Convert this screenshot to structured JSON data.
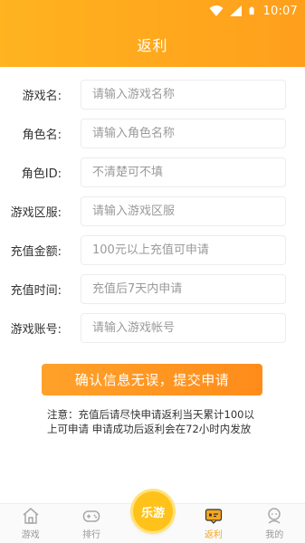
{
  "status_bar": {
    "time": "10:07"
  },
  "header": {
    "title": "返利"
  },
  "form": {
    "fields": [
      {
        "label": "游戏名:",
        "placeholder": "请输入游戏名称"
      },
      {
        "label": "角色名:",
        "placeholder": "请输入角色名称"
      },
      {
        "label": "角色ID:",
        "placeholder": "不清楚可不填"
      },
      {
        "label": "游戏区服:",
        "placeholder": "请输入游戏区服"
      },
      {
        "label": "充值金额:",
        "placeholder": "100元以上充值可申请"
      },
      {
        "label": "充值时间:",
        "placeholder": "充值后7天内申请"
      },
      {
        "label": "游戏账号:",
        "placeholder": "请输入游戏帐号"
      }
    ],
    "submit_label": "确认信息无误，提交申请",
    "notice": "注意：充值后请尽快申请返利当天累计100以上可申请 申请成功后返利会在72小时内发放"
  },
  "tabbar": {
    "items": [
      {
        "label": "游戏",
        "icon": "home-icon",
        "active": false
      },
      {
        "label": "排行",
        "icon": "gamepad-icon",
        "active": false
      },
      {
        "label": "",
        "icon": "center-logo",
        "active": false
      },
      {
        "label": "返利",
        "icon": "rebate-icon",
        "active": true
      },
      {
        "label": "我的",
        "icon": "profile-icon",
        "active": false
      }
    ],
    "center_label": "乐游"
  },
  "colors": {
    "accent": "#ffa21f",
    "active_tab": "#f5a623"
  }
}
